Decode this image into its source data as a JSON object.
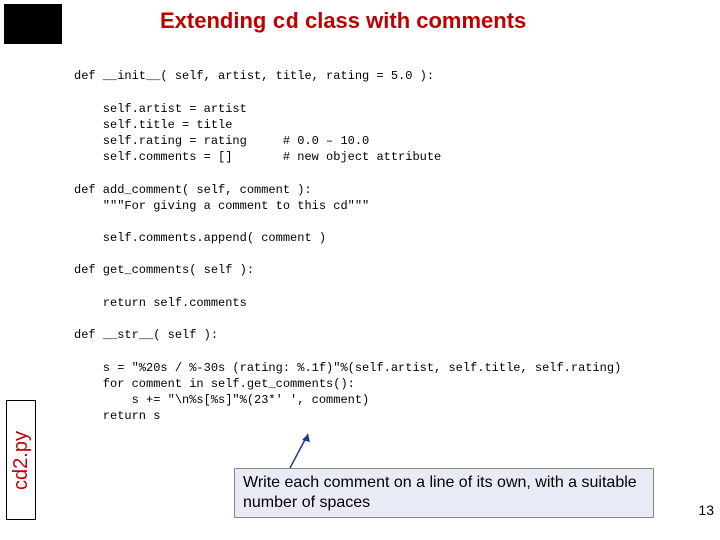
{
  "title": {
    "pre": "Extending ",
    "code": "cd",
    "post": " class with comments"
  },
  "code": {
    "l01": "def __init__( self, artist, title, rating = 5.0 ):",
    "l02": "",
    "l03": "    self.artist = artist",
    "l04": "    self.title = title",
    "l05": "    self.rating = rating     # 0.0 – 10.0",
    "l06": "    self.comments = []       # new object attribute",
    "l07": "",
    "l08": "def add_comment( self, comment ):",
    "l09": "    \"\"\"For giving a comment to this cd\"\"\"",
    "l10": "",
    "l11": "    self.comments.append( comment )",
    "l12": "",
    "l13": "def get_comments( self ):",
    "l14": "",
    "l15": "    return self.comments",
    "l16": "",
    "l17": "def __str__( self ):",
    "l18": "",
    "l19": "    s = \"%20s / %-30s (rating: %.1f)\"%(self.artist, self.title, self.rating)",
    "l20": "    for comment in self.get_comments():",
    "l21": "        s += \"\\n%s[%s]\"%(23*' ', comment)",
    "l22": "    return s"
  },
  "side_label": "cd2.py",
  "note": "Write each comment on a line of its own, with a suitable number of spaces",
  "page_number": "13"
}
